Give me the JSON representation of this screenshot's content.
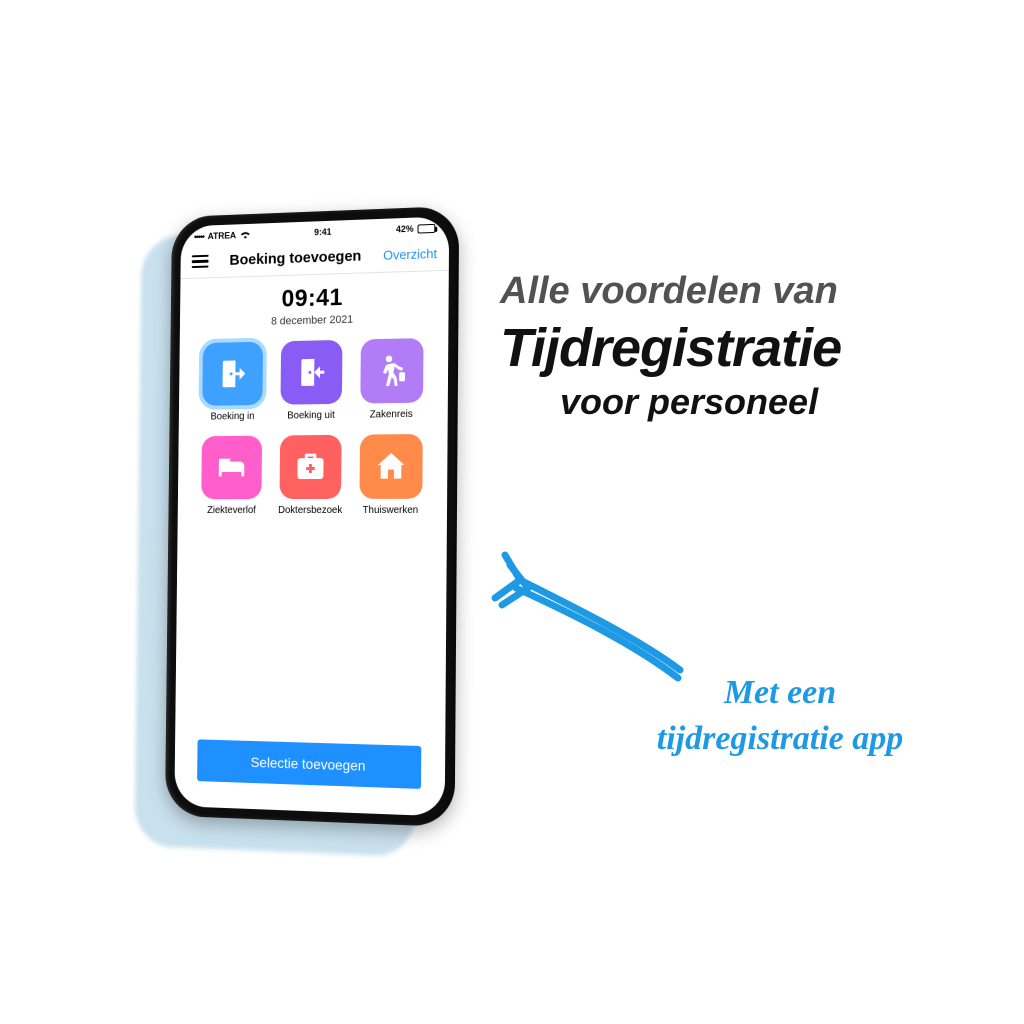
{
  "statusbar": {
    "signal_dots": "•••••",
    "carrier": "ATREA",
    "time": "9:41",
    "battery_pct": "42%"
  },
  "header": {
    "title": "Boeking toevoegen",
    "right_link": "Overzicht"
  },
  "clock": {
    "time": "09:41",
    "date": "8 december 2021"
  },
  "tiles": [
    {
      "label": "Boeking in",
      "icon": "door-in-icon",
      "color": "c0",
      "selected": true
    },
    {
      "label": "Boeking uit",
      "icon": "door-out-icon",
      "color": "c1",
      "selected": false
    },
    {
      "label": "Zakenreis",
      "icon": "traveler-icon",
      "color": "c2",
      "selected": false
    },
    {
      "label": "Ziekteverlof",
      "icon": "bed-icon",
      "color": "c3",
      "selected": false
    },
    {
      "label": "Doktersbezoek",
      "icon": "medkit-icon",
      "color": "c4",
      "selected": false
    },
    {
      "label": "Thuiswerken",
      "icon": "house-icon",
      "color": "c5",
      "selected": false
    }
  ],
  "primary_button": "Selectie toevoegen",
  "marketing": {
    "line1": "Alle voordelen van",
    "line2": "Tijdregistratie",
    "line3": "voor personeel",
    "hand1": "Met een",
    "hand2": "tijdregistratie app"
  },
  "colors": {
    "accent": "#1e90ff",
    "shadow": "#c9e1ee",
    "hand": "#1e9ae4"
  }
}
